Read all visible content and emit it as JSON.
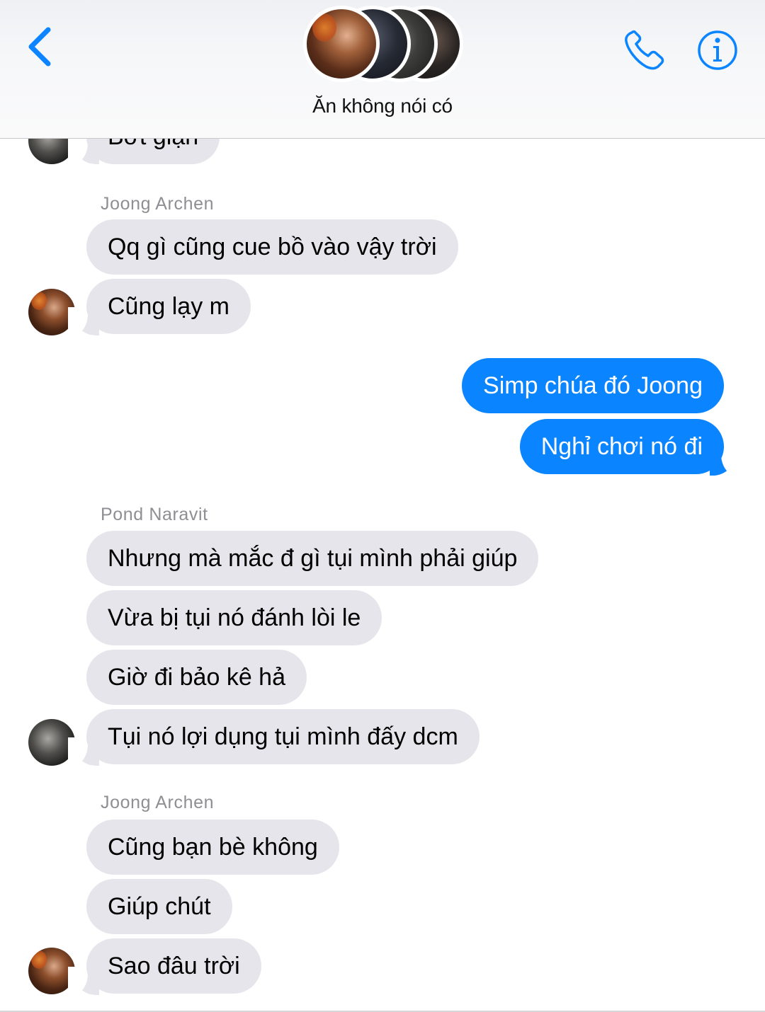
{
  "header": {
    "title": "Ăn không nói có",
    "back_icon": "chevron-left-icon",
    "call_icon": "phone-icon",
    "info_icon": "info-icon",
    "accent_color": "#0a84ff"
  },
  "messages": {
    "partial_top": "Bớt giận",
    "group1": {
      "sender": "Joong Archen",
      "msgs": [
        "Qq gì cũng cue bồ vào vậy trời",
        "Cũng lạy m"
      ]
    },
    "outgoing": [
      "Simp chúa đó Joong",
      "Nghỉ chơi nó đi"
    ],
    "group2": {
      "sender": "Pond Naravit",
      "msgs": [
        "Nhưng mà mắc đ gì tụi mình phải giúp",
        "Vừa bị tụi nó đánh lòi le",
        "Giờ đi bảo kê hả",
        "Tụi nó lợi dụng tụi mình đấy dcm"
      ]
    },
    "group3": {
      "sender": "Joong Archen",
      "msgs": [
        "Cũng bạn bè không",
        "Giúp chút",
        "Sao đâu trời"
      ]
    }
  },
  "colors": {
    "incoming_bubble": "#e6e5eb",
    "outgoing_bubble": "#0a84ff"
  }
}
